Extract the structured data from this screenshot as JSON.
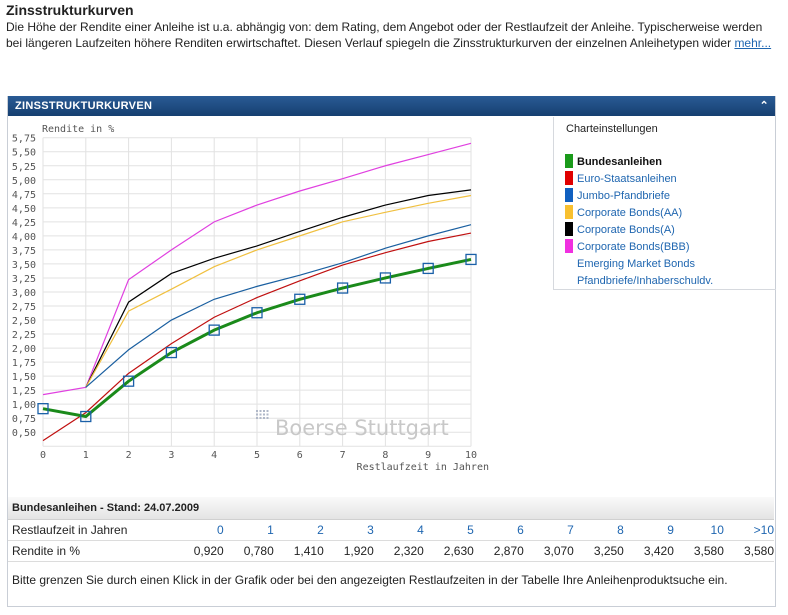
{
  "header": {
    "title": "Zinsstrukturkurven",
    "intro": "Die Höhe der Rendite einer Anleihe ist u.a. abhängig von: dem Rating, dem Angebot oder der Restlaufzeit der Anleihe. Typischerweise werden bei längeren Laufzeiten höhere Renditen erwirtschaftet. Diesen Verlauf spiegeln die Zinsstrukturkurven der einzelnen Anleihetypen wider ",
    "more_link": "mehr..."
  },
  "panel": {
    "title": "ZINSSTRUKTURKURVEN",
    "collapse_icon": "double-chevron-up"
  },
  "legend": {
    "title": "Charteinstellungen",
    "items": [
      {
        "label": "Bundesanleihen",
        "color": "#1a9a1a",
        "active": true
      },
      {
        "label": "Euro-Staatsanleihen",
        "color": "#e00000"
      },
      {
        "label": "Jumbo-Pfandbriefe",
        "color": "#1060c0"
      },
      {
        "label": "Corporate Bonds(AA)",
        "color": "#f8c030"
      },
      {
        "label": "Corporate Bonds(A)",
        "color": "#000000"
      },
      {
        "label": "Corporate Bonds(BBB)",
        "color": "#f030e0"
      },
      {
        "label": "Emerging Market Bonds",
        "color": null
      },
      {
        "label": "Pfandbriefe/Inhaberschuldv.",
        "color": null
      }
    ]
  },
  "chart_data": {
    "type": "line",
    "ylabel": "Rendite in %",
    "xlabel": "Restlaufzeit in Jahren",
    "x": [
      0,
      1,
      2,
      3,
      4,
      5,
      6,
      7,
      8,
      9,
      10
    ],
    "xlim": [
      0,
      10
    ],
    "ylim": [
      0.25,
      5.75
    ],
    "yticks": [
      "0,50",
      "0,75",
      "1,00",
      "1,25",
      "1,50",
      "1,75",
      "2,00",
      "2,25",
      "2,50",
      "2,75",
      "3,00",
      "3,25",
      "3,50",
      "3,75",
      "4,00",
      "4,25",
      "4,50",
      "4,75",
      "5,00",
      "5,25",
      "5,50",
      "5,75"
    ],
    "xticks": [
      "0",
      "1",
      "2",
      "3",
      "4",
      "5",
      "6",
      "7",
      "8",
      "9",
      "10"
    ],
    "grid": true,
    "watermark": "Boerse Stuttgart",
    "series": [
      {
        "name": "Corporate Bonds(BBB)",
        "color": "#e040e0",
        "values": [
          1.17,
          1.3,
          3.22,
          3.75,
          4.25,
          4.55,
          4.8,
          5.02,
          5.25,
          5.45,
          5.65
        ]
      },
      {
        "name": "Corporate Bonds(A)",
        "color": "#000000",
        "values": [
          null,
          1.3,
          2.82,
          3.33,
          3.6,
          3.82,
          4.08,
          4.33,
          4.55,
          4.72,
          4.82
        ]
      },
      {
        "name": "Corporate Bonds(AA)",
        "color": "#f0c040",
        "values": [
          null,
          1.3,
          2.66,
          3.05,
          3.45,
          3.75,
          4.0,
          4.25,
          4.42,
          4.58,
          4.72
        ]
      },
      {
        "name": "Jumbo-Pfandbriefe",
        "color": "#1a5fa0",
        "values": [
          null,
          1.3,
          1.97,
          2.5,
          2.87,
          3.1,
          3.3,
          3.52,
          3.78,
          4.0,
          4.2
        ]
      },
      {
        "name": "Euro-Staatsanleihen",
        "color": "#c01010",
        "values": [
          0.35,
          0.85,
          1.55,
          2.08,
          2.55,
          2.9,
          3.2,
          3.48,
          3.7,
          3.9,
          4.05
        ]
      },
      {
        "name": "Bundesanleihen",
        "color": "#1a8a1a",
        "markers": true,
        "values": [
          0.92,
          0.78,
          1.41,
          1.92,
          2.32,
          2.63,
          2.87,
          3.07,
          3.25,
          3.42,
          3.58
        ]
      }
    ]
  },
  "table": {
    "title": "Bundesanleihen - Stand: 24.07.2009",
    "row1_label": "Restlaufzeit in Jahren",
    "years": [
      "0",
      "1",
      "2",
      "3",
      "4",
      "5",
      "6",
      "7",
      "8",
      "9",
      "10",
      ">10"
    ],
    "row2_label": "Rendite in %",
    "yields": [
      "0,920",
      "0,780",
      "1,410",
      "1,920",
      "2,320",
      "2,630",
      "2,870",
      "3,070",
      "3,250",
      "3,420",
      "3,580",
      "3,580"
    ]
  },
  "note": "Bitte grenzen Sie durch einen Klick in der Grafik oder bei den angezeigten Restlaufzeiten in der Tabelle Ihre Anleihenproduktsuche ein."
}
